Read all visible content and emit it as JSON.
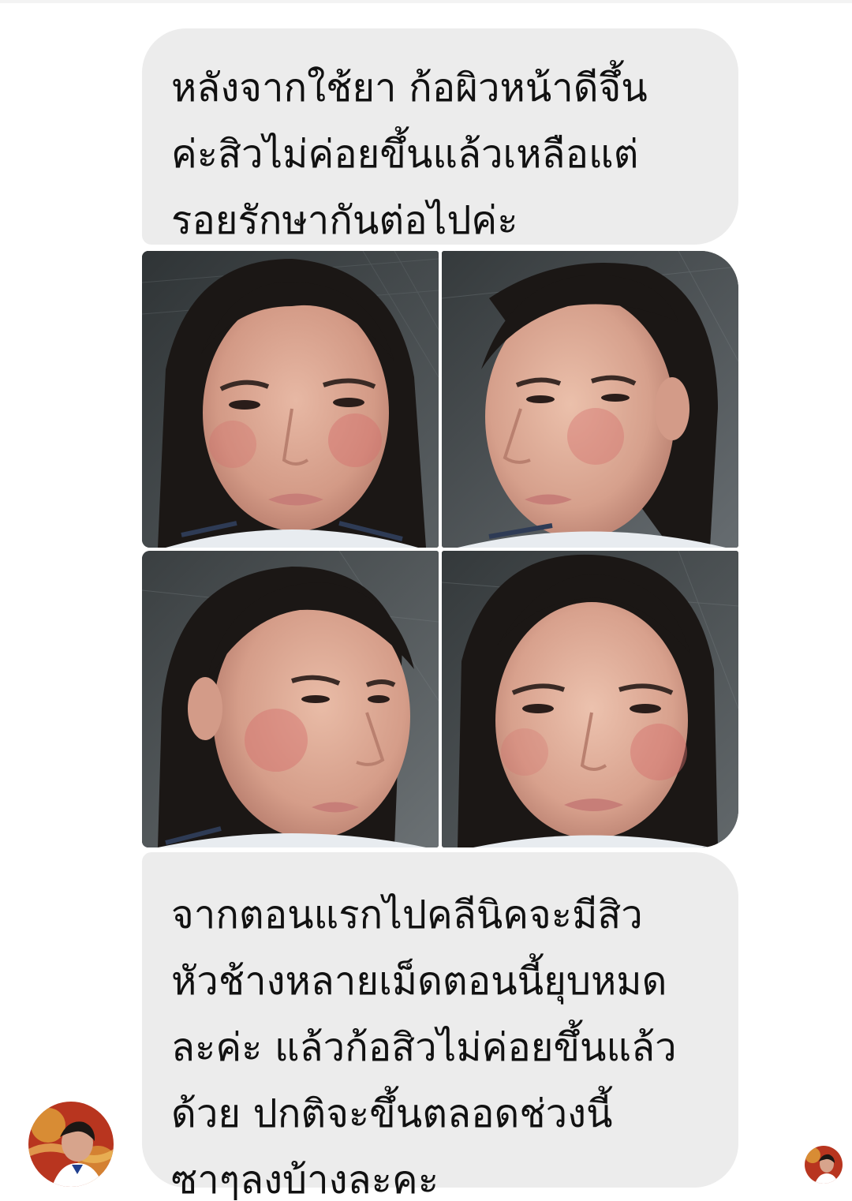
{
  "conversation": {
    "messages": [
      {
        "type": "text",
        "lines": [
          "หลังจากใช้ยา ก้อผิวหน้าดีจึ้น",
          "ค่ะสิวไม่ค่อยขึ้นแล้วเหลือแต่",
          "รอยรักษากันต่อไปค่ะ"
        ]
      },
      {
        "type": "photos",
        "photos": [
          {
            "name": "selfie-front-before"
          },
          {
            "name": "selfie-left-profile"
          },
          {
            "name": "selfie-right-profile"
          },
          {
            "name": "selfie-front-after"
          }
        ]
      },
      {
        "type": "text",
        "lines": [
          "จากตอนแรกไปคลีนิคจะมีสิว",
          "หัวช้างหลายเม็ดตอนนี้ยุบหมด",
          "ละค่ะ แล้วก้อสิวไม่ค่อยขึ้นแล้ว",
          "ด้วย ปกติจะขึ้นตลอดช่วงนี้",
          "ซาๆลงบ้างละคะ"
        ]
      }
    ]
  },
  "colors": {
    "bubble_background": "#ececec",
    "text": "#111111",
    "page_background": "#ffffff"
  },
  "icons": {
    "sender_avatar": "user-avatar-icon",
    "seen_indicator": "seen-avatar-icon"
  }
}
